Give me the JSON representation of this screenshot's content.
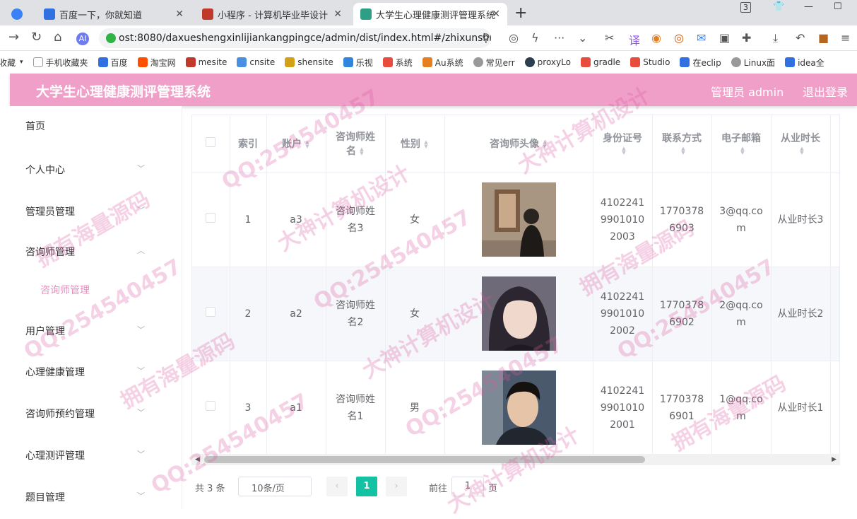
{
  "browser": {
    "tabs": [
      {
        "label": "百度一下，你就知道",
        "active": false
      },
      {
        "label": "小程序 - 计算机毕业毕设计",
        "active": false
      },
      {
        "label": "大学生心理健康测评管理系统",
        "active": true
      }
    ],
    "tab_count": "3",
    "url": "ost:8080/daxueshengxinlijiankangpingce/admin/dist/index.html#/zhixunshi",
    "bookmarks": [
      "收藏",
      "手机收藏夹",
      "百度",
      "淘宝网",
      "mesite",
      "cnsite",
      "shensite",
      "乐视",
      "系统",
      "Au系统",
      "常见err",
      "proxyLo",
      "gradle",
      "Studio",
      "在eclip",
      "Linux面",
      "idea全"
    ]
  },
  "header": {
    "title": "大学生心理健康测评管理系统",
    "user": "管理员 admin",
    "logout": "退出登录"
  },
  "sidebar": {
    "items": [
      {
        "label": "首页"
      },
      {
        "label": "个人中心"
      },
      {
        "label": "管理员管理"
      },
      {
        "label": "咨询师管理"
      },
      {
        "label": "咨询师管理"
      },
      {
        "label": "用户管理"
      },
      {
        "label": "心理健康管理"
      },
      {
        "label": "咨询师预约管理"
      },
      {
        "label": "心理测评管理"
      },
      {
        "label": "题目管理"
      }
    ]
  },
  "table": {
    "headers": [
      "索引",
      "账户",
      "咨询师姓名",
      "性别",
      "咨询师头像",
      "身份证号",
      "联系方式",
      "电子邮箱",
      "从业时长"
    ],
    "rows": [
      {
        "index": "1",
        "account": "a3",
        "name": "咨询师姓名3",
        "gender": "女",
        "idcard": "410224199010102003",
        "phone": "17703786903",
        "email": "3@qq.com",
        "years": "从业时长3"
      },
      {
        "index": "2",
        "account": "a2",
        "name": "咨询师姓名2",
        "gender": "女",
        "idcard": "410224199010102002",
        "phone": "17703786902",
        "email": "2@qq.com",
        "years": "从业时长2"
      },
      {
        "index": "3",
        "account": "a1",
        "name": "咨询师姓名1",
        "gender": "男",
        "idcard": "410224199010102001",
        "phone": "17703786901",
        "email": "1@qq.com",
        "years": "从业时长1"
      }
    ]
  },
  "pagination": {
    "total": "共 3 条",
    "page_size": "10条/页",
    "current_page": "1",
    "goto_label": "前往",
    "goto_value": "1",
    "page_suffix": "页"
  },
  "watermark": {
    "texts": [
      "QQ:254540457",
      "大神计算机设计",
      "拥有海量源码"
    ]
  },
  "colors": {
    "header_bg": "#ef9fc8",
    "accent": "#13c2a3",
    "submenu_active": "#e98ec0"
  }
}
